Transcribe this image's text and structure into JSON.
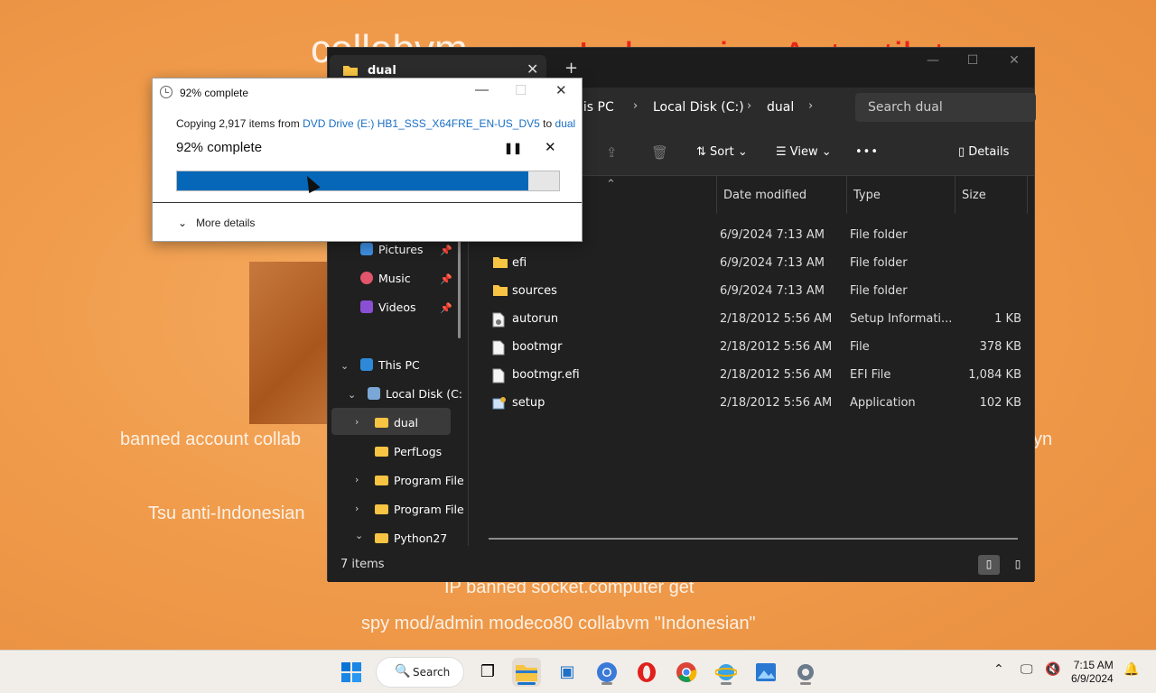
{
  "wallpaper": {
    "line1_white": "collabvm",
    "line1_red": "Indonesian Autostilet",
    "line2_left": "banned account collab",
    "line2_right": "yn",
    "line3": "Tsu anti-Indonesian",
    "line4": "IP banned socket.computer get",
    "line5": "spy mod/admin modeco80 collabvm \"Indonesian\""
  },
  "explorer": {
    "tab_label": "dual",
    "new_tab": "+",
    "close": "✕",
    "breadcrumbs": [
      "his PC",
      "Local Disk (C:)",
      "dual"
    ],
    "search_placeholder": "Search dual",
    "toolbar": {
      "sort": "Sort",
      "view": "View",
      "more": "•••",
      "details": "Details"
    },
    "nav": {
      "pictures": "Pictures",
      "music": "Music",
      "videos": "Videos",
      "this_pc": "This PC",
      "local_disk": "Local Disk (C:",
      "dual": "dual",
      "perflogs": "PerfLogs",
      "program_files": "Program File",
      "program_files_x86": "Program File",
      "python27": "Python27"
    },
    "columns": {
      "date": "Date modified",
      "type": "Type",
      "size": "Size"
    },
    "files": [
      {
        "name": "",
        "date": "6/9/2024 7:13 AM",
        "type": "File folder",
        "size": "",
        "icon": "folder"
      },
      {
        "name": "efi",
        "date": "6/9/2024 7:13 AM",
        "type": "File folder",
        "size": "",
        "icon": "folder"
      },
      {
        "name": "sources",
        "date": "6/9/2024 7:13 AM",
        "type": "File folder",
        "size": "",
        "icon": "folder"
      },
      {
        "name": "autorun",
        "date": "2/18/2012 5:56 AM",
        "type": "Setup Informati...",
        "size": "1 KB",
        "icon": "setup-info"
      },
      {
        "name": "bootmgr",
        "date": "2/18/2012 5:56 AM",
        "type": "File",
        "size": "378 KB",
        "icon": "file"
      },
      {
        "name": "bootmgr.efi",
        "date": "2/18/2012 5:56 AM",
        "type": "EFI File",
        "size": "1,084 KB",
        "icon": "file"
      },
      {
        "name": "setup",
        "date": "2/18/2012 5:56 AM",
        "type": "Application",
        "size": "102 KB",
        "icon": "application"
      }
    ],
    "status": "7 items"
  },
  "copy_dialog": {
    "title": "92% complete",
    "copying_prefix": "Copying 2,917 items from ",
    "source": "DVD Drive (E:) HB1_SSS_X64FRE_EN-US_DV5",
    "to_word": " to ",
    "destination": "dual",
    "percent_text": "92% complete",
    "progress": 0.92,
    "more_details": "More details"
  },
  "taskbar": {
    "search_label": "Search",
    "time": "7:15 AM",
    "date": "6/9/2024"
  },
  "colors": {
    "accent": "#0667b8",
    "folder": "#f7c443",
    "link": "#1a6fc4"
  }
}
